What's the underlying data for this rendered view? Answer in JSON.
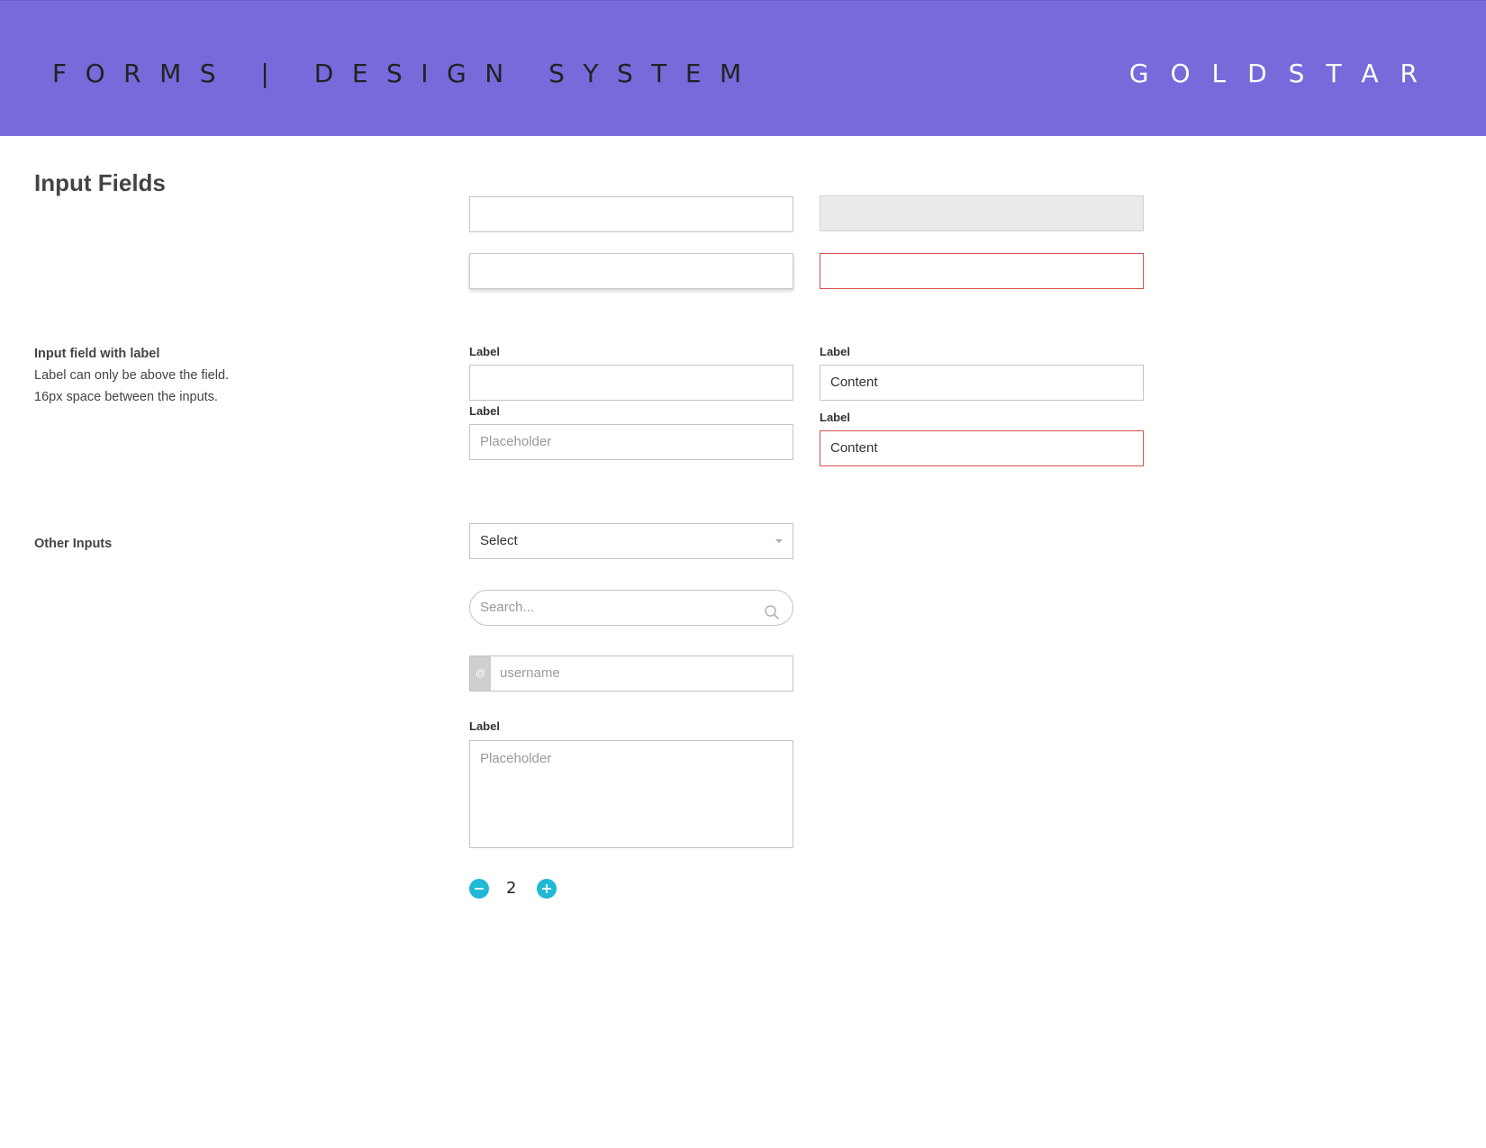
{
  "header": {
    "title": "FORMS | DESIGN SYSTEM",
    "brand": "GOLDSTAR",
    "color": "#776adb"
  },
  "sections": {
    "input_fields": {
      "title": "Input Fields"
    },
    "labeled": {
      "title": "Input field with label",
      "line1": "Label can only be above the field.",
      "line2": "16px space between the inputs."
    },
    "other": {
      "title": "Other Inputs"
    }
  },
  "labeled_fields": {
    "left_top_label": "Label",
    "left_bottom_label": "Label",
    "left_bottom_placeholder": "Placeholder",
    "right_top_label": "Label",
    "right_top_value": "Content",
    "right_bottom_label": "Label",
    "right_bottom_value": "Content"
  },
  "other_inputs": {
    "select_value": "Select",
    "search_placeholder": "Search...",
    "username_prefix": "@",
    "username_placeholder": "username",
    "textarea_label": "Label",
    "textarea_placeholder": "Placeholder",
    "stepper_value": "2"
  },
  "colors": {
    "accent": "#1fb8d6",
    "error": "#d9534f",
    "disabled": "#eaeaea"
  }
}
